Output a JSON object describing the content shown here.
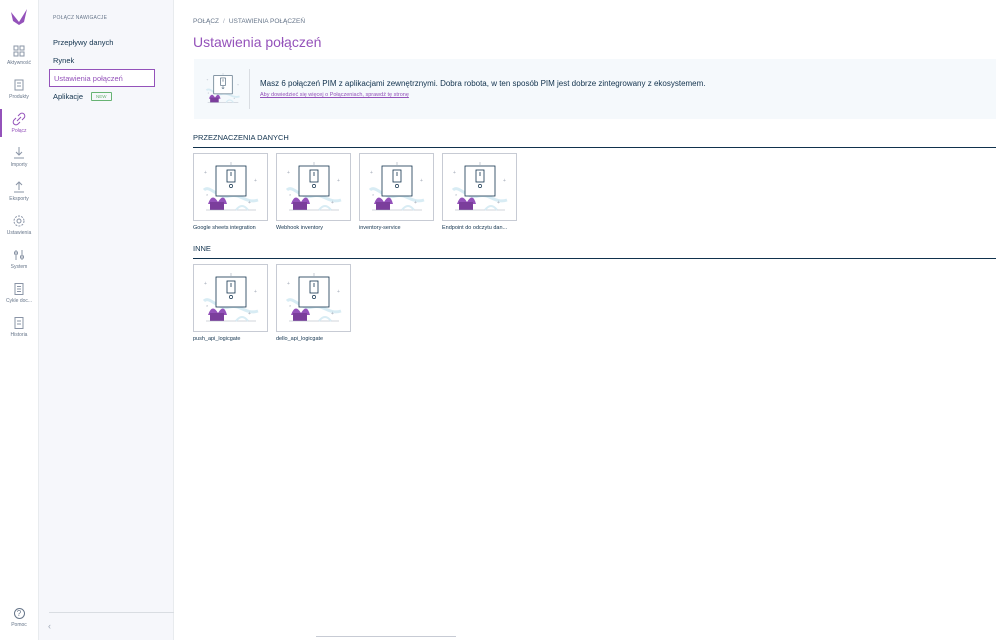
{
  "rail": {
    "items": [
      {
        "label": "Aktywność",
        "icon": "activity-icon"
      },
      {
        "label": "Produkty",
        "icon": "products-icon"
      },
      {
        "label": "Połącz",
        "icon": "link-icon"
      },
      {
        "label": "Importy",
        "icon": "import-icon"
      },
      {
        "label": "Eksporty",
        "icon": "export-icon"
      },
      {
        "label": "Ustawienia",
        "icon": "gear-icon"
      },
      {
        "label": "System",
        "icon": "sliders-icon"
      },
      {
        "label": "Cykle doc...",
        "icon": "document-icon"
      },
      {
        "label": "Historia",
        "icon": "history-icon"
      }
    ],
    "help": {
      "label": "Pomoc",
      "symbol": "?"
    }
  },
  "subnav": {
    "title": "Połącz nawigacje",
    "items": [
      {
        "label": "Przepływy danych"
      },
      {
        "label": "Rynek"
      },
      {
        "label": "Ustawienia połączeń"
      },
      {
        "label": "Aplikacje",
        "badge": "NEW"
      }
    ],
    "collapse": "‹"
  },
  "breadcrumb": {
    "root": "Połącz",
    "separator": "/",
    "current": "Ustawienia połączeń"
  },
  "page_title": "Ustawienia połączeń",
  "helper": {
    "text": "Masz 6 połączeń PIM z aplikacjami zewnętrznymi. Dobra robota, w ten sposób PIM jest dobrze zintegrowany z ekosystemem.",
    "link": "Aby dowiedzieć się więcej o Połączeniach, sprawdź tę stronę"
  },
  "sections": [
    {
      "title": "Przeznaczenia danych",
      "tiles": [
        {
          "name": "Google sheets integration"
        },
        {
          "name": "Webhook inventory"
        },
        {
          "name": "inventory-service"
        },
        {
          "name": "Endpoint do odczytu dan..."
        }
      ]
    },
    {
      "title": "Inne",
      "tiles": [
        {
          "name": "push_api_logicgate"
        },
        {
          "name": "dello_api_logicgate"
        }
      ]
    }
  ],
  "colors": {
    "accent": "#9452ba",
    "text": "#11324d",
    "muted": "#67768a",
    "new_badge": "#67b373"
  }
}
